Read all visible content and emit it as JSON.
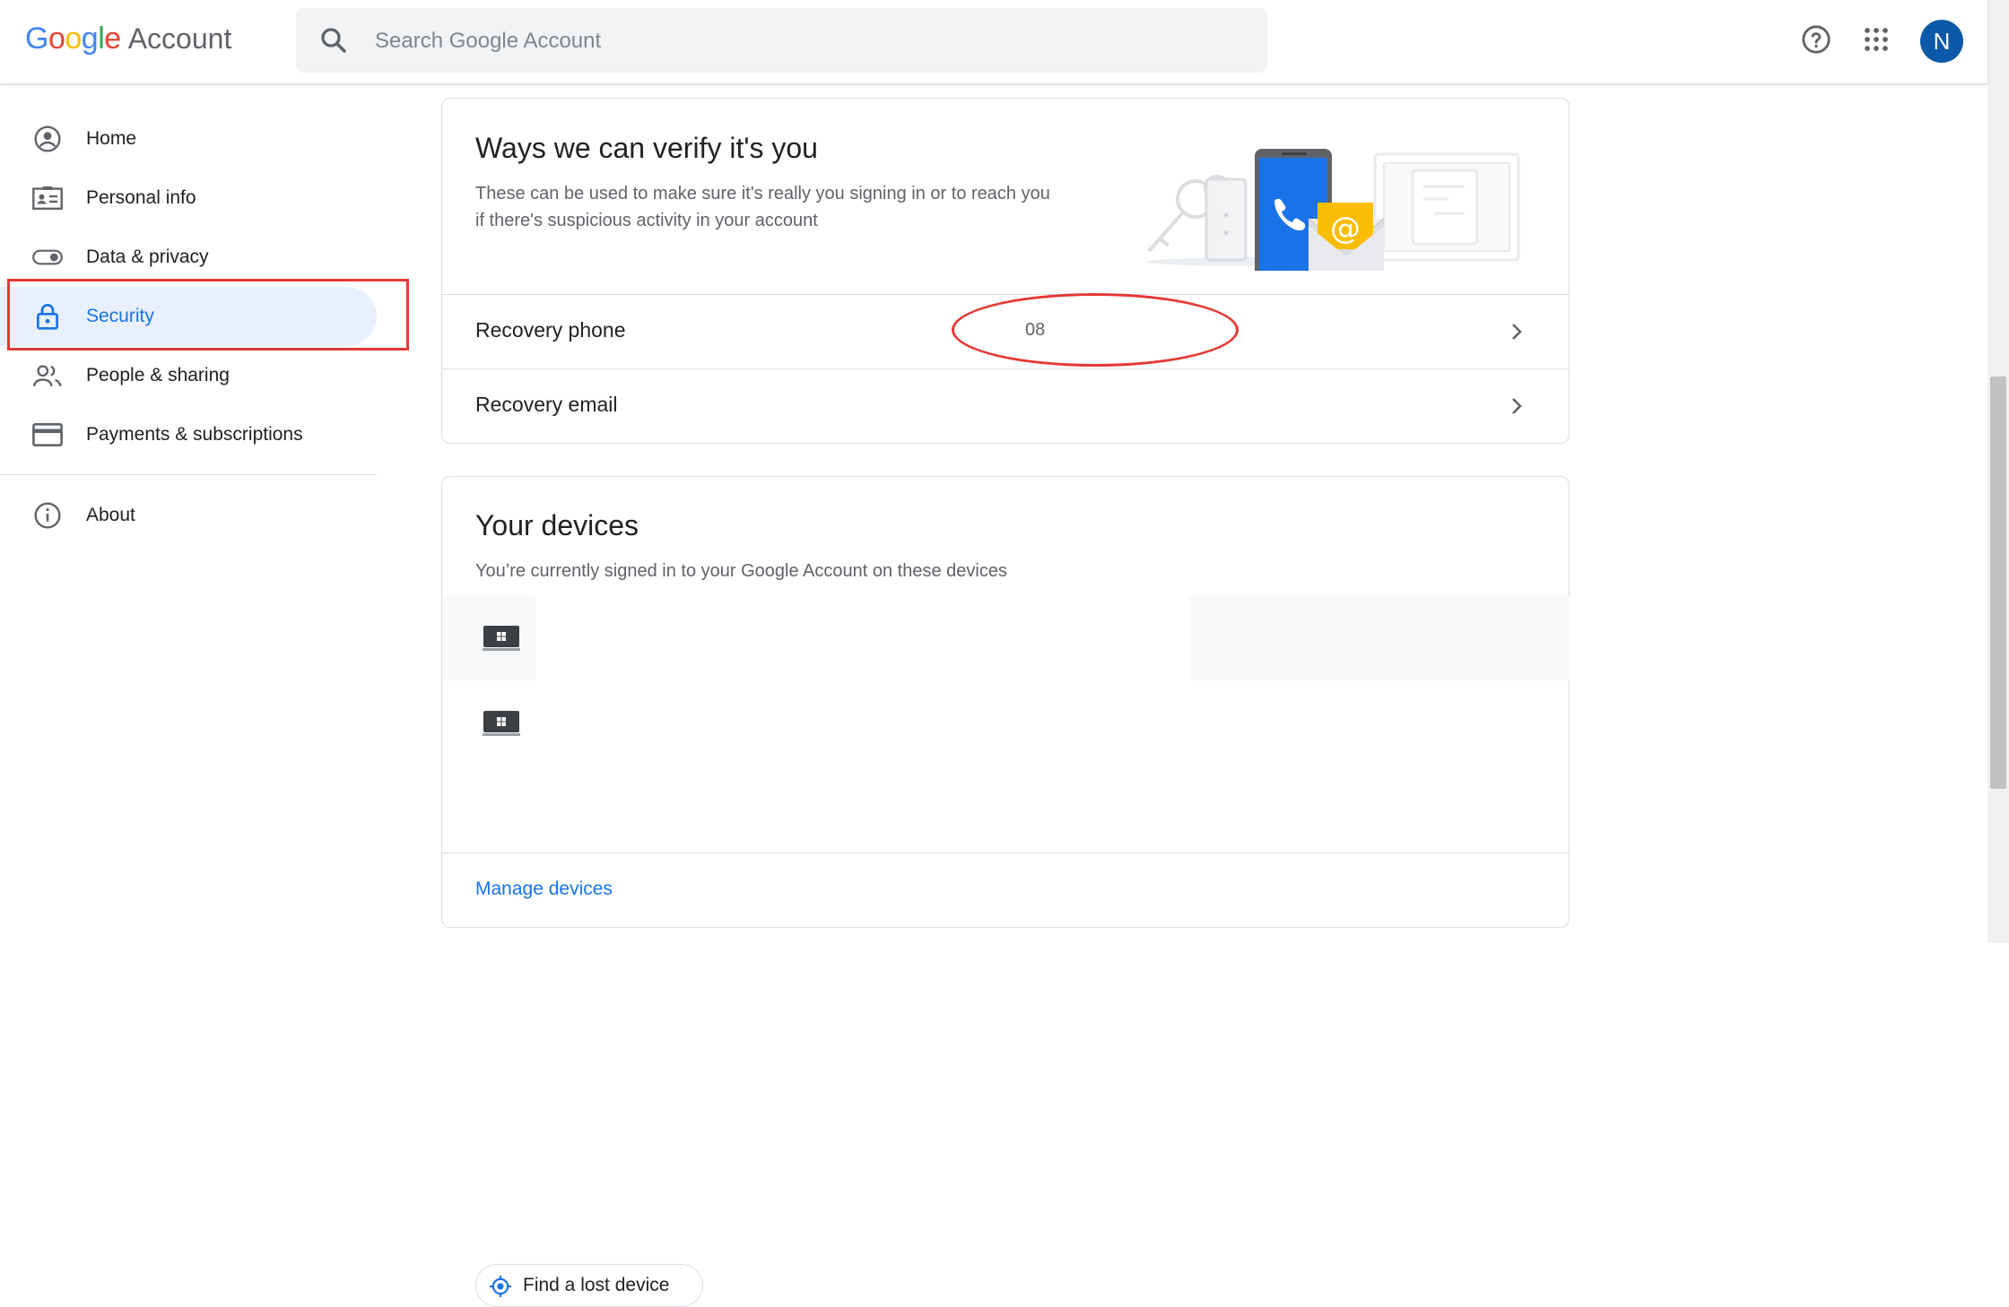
{
  "header": {
    "logo_google": "Google",
    "logo_account": "Account",
    "search_placeholder": "Search Google Account",
    "avatar_initial": "N",
    "icons": [
      "search-icon",
      "help-icon",
      "apps-grid-icon"
    ]
  },
  "sidebar": {
    "items": [
      {
        "label": "Home",
        "icon": "account-circle-icon"
      },
      {
        "label": "Personal info",
        "icon": "id-card-icon"
      },
      {
        "label": "Data & privacy",
        "icon": "toggle-icon"
      },
      {
        "label": "Security",
        "icon": "lock-icon",
        "active": true
      },
      {
        "label": "People & sharing",
        "icon": "people-icon"
      },
      {
        "label": "Payments & subscriptions",
        "icon": "credit-card-icon"
      }
    ],
    "about": {
      "label": "About",
      "icon": "info-icon"
    }
  },
  "verify_card": {
    "title": "Ways we can verify it's you",
    "description_line1": "These can be used to make sure it's really you signing in or to reach you",
    "description_line2": "if there's suspicious activity in your account",
    "rows": [
      {
        "label": "Recovery phone",
        "value": "08"
      },
      {
        "label": "Recovery email",
        "value": ""
      }
    ]
  },
  "devices_card": {
    "title": "Your devices",
    "description": "You’re currently signed in to your Google Account on these devices",
    "find_lost_device": "Find a lost device",
    "manage_devices": "Manage devices"
  },
  "colors": {
    "accent": "#1a73e8",
    "active_bg": "#e8f0fe",
    "annotation_red": "#e53935",
    "avatar_bg": "#0b57a8"
  }
}
